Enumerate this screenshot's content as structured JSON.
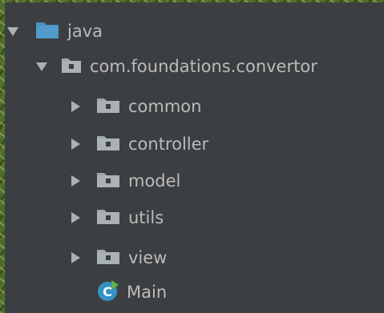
{
  "tree": {
    "root": {
      "label": "java",
      "icon": "source-folder-icon",
      "expanded": true,
      "toggle_icon": "expand-arrow-down-icon"
    },
    "package": {
      "label": "com.foundations.convertor",
      "icon": "package-icon",
      "expanded": true,
      "toggle_icon": "expand-arrow-down-icon"
    },
    "children": [
      {
        "label": "common",
        "icon": "package-icon",
        "toggle_icon": "collapse-arrow-right-icon"
      },
      {
        "label": "controller",
        "icon": "package-icon",
        "toggle_icon": "collapse-arrow-right-icon"
      },
      {
        "label": "model",
        "icon": "package-icon",
        "toggle_icon": "collapse-arrow-right-icon"
      },
      {
        "label": "utils",
        "icon": "package-icon",
        "toggle_icon": "collapse-arrow-right-icon"
      },
      {
        "label": "view",
        "icon": "package-icon",
        "toggle_icon": "collapse-arrow-right-icon"
      }
    ],
    "main_file": {
      "label": "Main",
      "icon": "java-class-run-icon"
    }
  },
  "colors": {
    "panel_background": "#3c3f41",
    "text": "#bbbbbb",
    "source_folder_blue": "#4a8fc1",
    "package_gray": "#9ea7ae",
    "class_icon_blue": "#3592c4",
    "run_badge_green": "#62b543"
  }
}
